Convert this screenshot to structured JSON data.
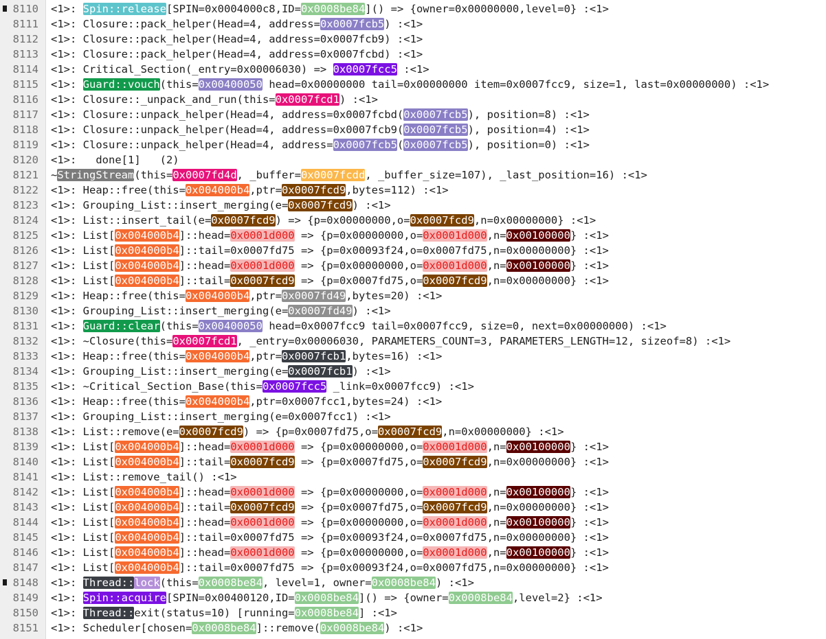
{
  "palette": {
    "spin": [
      "#5ec4cc",
      "#ffffff"
    ],
    "tid": [
      "#8fcb90",
      "#ffffff"
    ],
    "addr_b5": [
      "#8a7fc6",
      "#ffffff"
    ],
    "cs": [
      "#7b11e3",
      "#ffffff"
    ],
    "guard_kw": [
      "#129a4c",
      "#ffffff"
    ],
    "guard_this": [
      "#8a7fc6",
      "#ffffff"
    ],
    "closure": [
      "#e81179",
      "#ffffff"
    ],
    "strstream": [
      "#7b7b7b",
      "#ffffff"
    ],
    "ss_this": [
      "#e81179",
      "#ffffff"
    ],
    "ss_buf": [
      "#fcb74a",
      "#ffffff"
    ],
    "heap": [
      "#f66a2f",
      "#ffffff"
    ],
    "fcd9": [
      "#7a4100",
      "#ffffff"
    ],
    "head1": [
      "#f6b6b6",
      "#e81a1a"
    ],
    "n100": [
      "#5a0000",
      "#ffffff"
    ],
    "fd49": [
      "#8f8f8f",
      "#ffffff"
    ],
    "fcb1": [
      "#3a3e44",
      "#ffffff"
    ],
    "thread": [
      "#3a3e44",
      "#ffffff"
    ],
    "lockw": [
      "#b48fd9",
      "#ffffff"
    ]
  },
  "lines": [
    {
      "n": "8110",
      "bookmark": true,
      "segments": [
        [
          "<1>: "
        ],
        [
          "Spin::release",
          "spin"
        ],
        [
          "[SPIN=0x0004000c8,ID="
        ],
        [
          "0x0008be84",
          "tid"
        ],
        [
          "]() => {owner=0x00000000,level=0} :<1>"
        ]
      ]
    },
    {
      "n": "8111",
      "segments": [
        [
          "<1>: Closure::pack_helper(Head=4, address="
        ],
        [
          "0x0007fcb5",
          "addr_b5"
        ],
        [
          ") :<1>"
        ]
      ]
    },
    {
      "n": "8112",
      "segments": [
        [
          "<1>: Closure::pack_helper(Head=4, address=0x0007fcb9) :<1>"
        ]
      ]
    },
    {
      "n": "8113",
      "segments": [
        [
          "<1>: Closure::pack_helper(Head=4, address=0x0007fcbd) :<1>"
        ]
      ]
    },
    {
      "n": "8114",
      "segments": [
        [
          "<1>: Critical_Section(_entry=0x00006030) => "
        ],
        [
          "0x0007fcc5",
          "cs"
        ],
        [
          " :<1>"
        ]
      ]
    },
    {
      "n": "8115",
      "segments": [
        [
          "<1>: "
        ],
        [
          "Guard::vouch",
          "guard_kw"
        ],
        [
          "(this="
        ],
        [
          "0x00400050",
          "guard_this"
        ],
        [
          " head=0x00000000 tail=0x00000000 item=0x0007fcc9, size=1, last=0x00000000) :<1>"
        ]
      ]
    },
    {
      "n": "8116",
      "segments": [
        [
          "<1>: Closure::_unpack_and_run(this="
        ],
        [
          "0x0007fcd1",
          "closure"
        ],
        [
          ") :<1>"
        ]
      ]
    },
    {
      "n": "8117",
      "segments": [
        [
          "<1>: Closure::unpack_helper(Head=4, address=0x0007fcbd("
        ],
        [
          "0x0007fcb5",
          "addr_b5"
        ],
        [
          "), position=8) :<1>"
        ]
      ]
    },
    {
      "n": "8118",
      "segments": [
        [
          "<1>: Closure::unpack_helper(Head=4, address=0x0007fcb9("
        ],
        [
          "0x0007fcb5",
          "addr_b5"
        ],
        [
          "), position=4) :<1>"
        ]
      ]
    },
    {
      "n": "8119",
      "segments": [
        [
          "<1>: Closure::unpack_helper(Head=4, address="
        ],
        [
          "0x0007fcb5",
          "addr_b5"
        ],
        [
          "("
        ],
        [
          "0x0007fcb5",
          "addr_b5"
        ],
        [
          "), position=0) :<1>"
        ]
      ]
    },
    {
      "n": "8120",
      "segments": [
        [
          "<1>:   done[1]   (2)"
        ]
      ]
    },
    {
      "n": "8121",
      "segments": [
        [
          "~"
        ],
        [
          "StringStream",
          "strstream"
        ],
        [
          "(this="
        ],
        [
          "0x0007fd4d",
          "ss_this"
        ],
        [
          ", _buffer="
        ],
        [
          "0x0007fcdd",
          "ss_buf"
        ],
        [
          ", _buffer_size=107), _last_position=16) :<1>"
        ]
      ]
    },
    {
      "n": "8122",
      "segments": [
        [
          "<1>: Heap::free(this="
        ],
        [
          "0x004000b4",
          "heap"
        ],
        [
          ",ptr="
        ],
        [
          "0x0007fcd9",
          "fcd9"
        ],
        [
          ",bytes=112) :<1>"
        ]
      ]
    },
    {
      "n": "8123",
      "segments": [
        [
          "<1>: Grouping_List::insert_merging(e="
        ],
        [
          "0x0007fcd9",
          "fcd9"
        ],
        [
          ") :<1>"
        ]
      ]
    },
    {
      "n": "8124",
      "segments": [
        [
          "<1>: List::insert_tail(e="
        ],
        [
          "0x0007fcd9",
          "fcd9"
        ],
        [
          ") => {p=0x00000000,o="
        ],
        [
          "0x0007fcd9",
          "fcd9"
        ],
        [
          ",n=0x00000000} :<1>"
        ]
      ]
    },
    {
      "n": "8125",
      "segments": [
        [
          "<1>: List["
        ],
        [
          "0x004000b4",
          "heap"
        ],
        [
          "]::head="
        ],
        [
          "0x0001d000",
          "head1"
        ],
        [
          " => {p=0x00000000,o="
        ],
        [
          "0x0001d000",
          "head1"
        ],
        [
          ",n="
        ],
        [
          "0x00100000",
          "n100"
        ],
        [
          "} :<1>"
        ]
      ]
    },
    {
      "n": "8126",
      "segments": [
        [
          "<1>: List["
        ],
        [
          "0x004000b4",
          "heap"
        ],
        [
          "]::tail=0x0007fd75 => {p=0x00093f24,o=0x0007fd75,n=0x00000000} :<1>"
        ]
      ]
    },
    {
      "n": "8127",
      "segments": [
        [
          "<1>: List["
        ],
        [
          "0x004000b4",
          "heap"
        ],
        [
          "]::head="
        ],
        [
          "0x0001d000",
          "head1"
        ],
        [
          " => {p=0x00000000,o="
        ],
        [
          "0x0001d000",
          "head1"
        ],
        [
          ",n="
        ],
        [
          "0x00100000",
          "n100"
        ],
        [
          "} :<1>"
        ]
      ]
    },
    {
      "n": "8128",
      "segments": [
        [
          "<1>: List["
        ],
        [
          "0x004000b4",
          "heap"
        ],
        [
          "]::tail="
        ],
        [
          "0x0007fcd9",
          "fcd9"
        ],
        [
          " => {p=0x0007fd75,o="
        ],
        [
          "0x0007fcd9",
          "fcd9"
        ],
        [
          ",n=0x00000000} :<1>"
        ]
      ]
    },
    {
      "n": "8129",
      "segments": [
        [
          "<1>: Heap::free(this="
        ],
        [
          "0x004000b4",
          "heap"
        ],
        [
          ",ptr="
        ],
        [
          "0x0007fd49",
          "fd49"
        ],
        [
          ",bytes=20) :<1>"
        ]
      ]
    },
    {
      "n": "8130",
      "segments": [
        [
          "<1>: Grouping_List::insert_merging(e="
        ],
        [
          "0x0007fd49",
          "fd49"
        ],
        [
          ") :<1>"
        ]
      ]
    },
    {
      "n": "8131",
      "segments": [
        [
          "<1>: "
        ],
        [
          "Guard::clear",
          "guard_kw"
        ],
        [
          "(this="
        ],
        [
          "0x00400050",
          "guard_this"
        ],
        [
          " head=0x0007fcc9 tail=0x0007fcc9, size=0, next=0x00000000) :<1>"
        ]
      ]
    },
    {
      "n": "8132",
      "segments": [
        [
          "<1>: ~Closure(this="
        ],
        [
          "0x0007fcd1",
          "closure"
        ],
        [
          ", _entry=0x00006030, PARAMETERS_COUNT=3, PARAMETERS_LENGTH=12, sizeof=8) :<1>"
        ]
      ]
    },
    {
      "n": "8133",
      "segments": [
        [
          "<1>: Heap::free(this="
        ],
        [
          "0x004000b4",
          "heap"
        ],
        [
          ",ptr="
        ],
        [
          "0x0007fcb1",
          "fcb1"
        ],
        [
          ",bytes=16) :<1>"
        ]
      ]
    },
    {
      "n": "8134",
      "segments": [
        [
          "<1>: Grouping_List::insert_merging(e="
        ],
        [
          "0x0007fcb1",
          "fcb1"
        ],
        [
          ") :<1>"
        ]
      ]
    },
    {
      "n": "8135",
      "segments": [
        [
          "<1>: ~Critical_Section_Base(this="
        ],
        [
          "0x0007fcc5",
          "cs"
        ],
        [
          " _link=0x0007fcc9) :<1>"
        ]
      ]
    },
    {
      "n": "8136",
      "segments": [
        [
          "<1>: Heap::free(this="
        ],
        [
          "0x004000b4",
          "heap"
        ],
        [
          ",ptr=0x0007fcc1,bytes=24) :<1>"
        ]
      ]
    },
    {
      "n": "8137",
      "segments": [
        [
          "<1>: Grouping_List::insert_merging(e=0x0007fcc1) :<1>"
        ]
      ]
    },
    {
      "n": "8138",
      "segments": [
        [
          "<1>: List::remove(e="
        ],
        [
          "0x0007fcd9",
          "fcd9"
        ],
        [
          ") => {p=0x0007fd75,o="
        ],
        [
          "0x0007fcd9",
          "fcd9"
        ],
        [
          ",n=0x00000000} :<1>"
        ]
      ]
    },
    {
      "n": "8139",
      "segments": [
        [
          "<1>: List["
        ],
        [
          "0x004000b4",
          "heap"
        ],
        [
          "]::head="
        ],
        [
          "0x0001d000",
          "head1"
        ],
        [
          " => {p=0x00000000,o="
        ],
        [
          "0x0001d000",
          "head1"
        ],
        [
          ",n="
        ],
        [
          "0x00100000",
          "n100"
        ],
        [
          "} :<1>"
        ]
      ]
    },
    {
      "n": "8140",
      "segments": [
        [
          "<1>: List["
        ],
        [
          "0x004000b4",
          "heap"
        ],
        [
          "]::tail="
        ],
        [
          "0x0007fcd9",
          "fcd9"
        ],
        [
          " => {p=0x0007fd75,o="
        ],
        [
          "0x0007fcd9",
          "fcd9"
        ],
        [
          ",n=0x00000000} :<1>"
        ]
      ]
    },
    {
      "n": "8141",
      "segments": [
        [
          "<1>: List::remove_tail() :<1>"
        ]
      ]
    },
    {
      "n": "8142",
      "segments": [
        [
          "<1>: List["
        ],
        [
          "0x004000b4",
          "heap"
        ],
        [
          "]::head="
        ],
        [
          "0x0001d000",
          "head1"
        ],
        [
          " => {p=0x00000000,o="
        ],
        [
          "0x0001d000",
          "head1"
        ],
        [
          ",n="
        ],
        [
          "0x00100000",
          "n100"
        ],
        [
          "} :<1>"
        ]
      ]
    },
    {
      "n": "8143",
      "segments": [
        [
          "<1>: List["
        ],
        [
          "0x004000b4",
          "heap"
        ],
        [
          "]::tail="
        ],
        [
          "0x0007fcd9",
          "fcd9"
        ],
        [
          " => {p=0x0007fd75,o="
        ],
        [
          "0x0007fcd9",
          "fcd9"
        ],
        [
          ",n=0x00000000} :<1>"
        ]
      ]
    },
    {
      "n": "8144",
      "segments": [
        [
          "<1>: List["
        ],
        [
          "0x004000b4",
          "heap"
        ],
        [
          "]::head="
        ],
        [
          "0x0001d000",
          "head1"
        ],
        [
          " => {p=0x00000000,o="
        ],
        [
          "0x0001d000",
          "head1"
        ],
        [
          ",n="
        ],
        [
          "0x00100000",
          "n100"
        ],
        [
          "} :<1>"
        ]
      ]
    },
    {
      "n": "8145",
      "segments": [
        [
          "<1>: List["
        ],
        [
          "0x004000b4",
          "heap"
        ],
        [
          "]::tail=0x0007fd75 => {p=0x00093f24,o=0x0007fd75,n=0x00000000} :<1>"
        ]
      ]
    },
    {
      "n": "8146",
      "segments": [
        [
          "<1>: List["
        ],
        [
          "0x004000b4",
          "heap"
        ],
        [
          "]::head="
        ],
        [
          "0x0001d000",
          "head1"
        ],
        [
          " => {p=0x00000000,o="
        ],
        [
          "0x0001d000",
          "head1"
        ],
        [
          ",n="
        ],
        [
          "0x00100000",
          "n100"
        ],
        [
          "} :<1>"
        ]
      ]
    },
    {
      "n": "8147",
      "segments": [
        [
          "<1>: List["
        ],
        [
          "0x004000b4",
          "heap"
        ],
        [
          "]::tail=0x0007fd75 => {p=0x00093f24,o=0x0007fd75,n=0x00000000} :<1>"
        ]
      ]
    },
    {
      "n": "8148",
      "bookmark": true,
      "segments": [
        [
          "<1>: "
        ],
        [
          "Thread::",
          "thread"
        ],
        [
          "lock",
          "lockw"
        ],
        [
          "(this="
        ],
        [
          "0x0008be84",
          "tid"
        ],
        [
          ", level=1, owner="
        ],
        [
          "0x0008be84",
          "tid"
        ],
        [
          ") :<1>"
        ]
      ]
    },
    {
      "n": "8149",
      "segments": [
        [
          "<1>: "
        ],
        [
          "Spin::acquire",
          "cs"
        ],
        [
          "[SPIN=0x00400120,ID="
        ],
        [
          "0x0008be84",
          "tid"
        ],
        [
          "]() => {owner="
        ],
        [
          "0x0008be84",
          "tid"
        ],
        [
          ",level=2} :<1>"
        ]
      ]
    },
    {
      "n": "8150",
      "segments": [
        [
          "<1>: "
        ],
        [
          "Thread::",
          "thread"
        ],
        [
          "exit(status=10) [running="
        ],
        [
          "0x0008be84",
          "tid"
        ],
        [
          "] :<1>"
        ]
      ]
    },
    {
      "n": "8151",
      "segments": [
        [
          "<1>: Scheduler[chosen="
        ],
        [
          "0x0008be84",
          "tid"
        ],
        [
          "]::remove("
        ],
        [
          "0x0008be84",
          "tid"
        ],
        [
          ") :<1>"
        ]
      ]
    }
  ]
}
